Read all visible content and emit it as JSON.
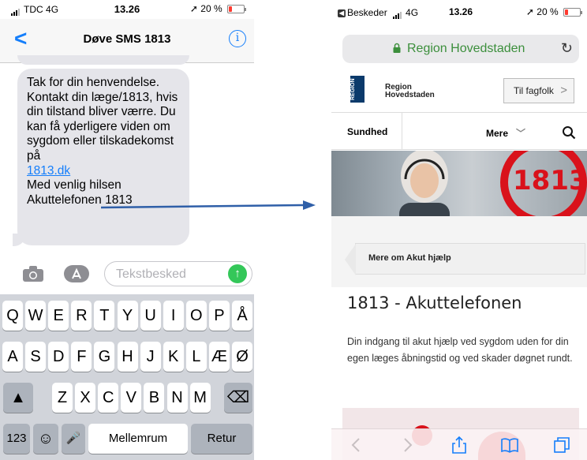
{
  "left_phone": {
    "status": {
      "carrier": "TDC",
      "network": "4G",
      "time": "13.26",
      "battery": "20 %",
      "battery_level": 0.2
    },
    "nav": {
      "title": "Døve SMS 1813"
    },
    "message": {
      "text_before_link": "Tak for din henvendelse. Kontakt din læge/1813, hvis din tilstand bliver værre. Du kan få yderligere viden om sygdom eller tilskadekomst på",
      "link": "1813.dk",
      "text_after_link": "Med venlig hilsen Akuttelefonen 1813"
    },
    "compose": {
      "placeholder": "Tekstbesked"
    },
    "keyboard": {
      "row1": [
        "Q",
        "W",
        "E",
        "R",
        "T",
        "Y",
        "U",
        "I",
        "O",
        "P",
        "Å"
      ],
      "row2": [
        "A",
        "S",
        "D",
        "F",
        "G",
        "H",
        "J",
        "K",
        "L",
        "Æ",
        "Ø"
      ],
      "row3": [
        "Z",
        "X",
        "C",
        "V",
        "B",
        "N",
        "M"
      ],
      "numbers_key": "123",
      "emoji_key": "☺",
      "space_key": "Mellemrum",
      "return_key": "Retur"
    }
  },
  "right_phone": {
    "status": {
      "back_app": "Beskeder",
      "network": "4G",
      "time": "13.26",
      "battery": "20 %",
      "battery_level": 0.2
    },
    "url": "Region Hovedstaden",
    "site": {
      "logo_mark": "REGION",
      "logo_text_1": "Region",
      "logo_text_2": "Hovedstaden",
      "professionals_button": "Til fagfolk",
      "nav_health": "Sundhed",
      "nav_more": "Mere",
      "hero_number": "1813",
      "breadcrumb": "Mere om Akut hjælp",
      "title": "1813 - Akuttelefonen",
      "intro": "Din indgang til akut hjælp ved sygdom uden for din egen læges åbningstid og ved skader døgnet rundt."
    }
  },
  "colors": {
    "ios_blue": "#147efb",
    "send_green": "#34c759",
    "bubble_gray": "#e5e5ea",
    "url_green": "#3c8f3c",
    "brand_red": "#d9121b",
    "arrow_blue": "#2f5fa8"
  }
}
